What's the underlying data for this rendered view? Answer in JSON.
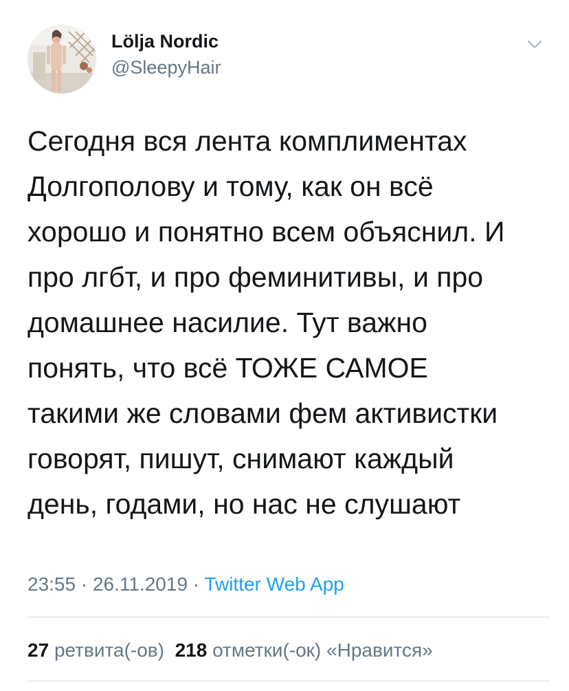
{
  "user": {
    "display_name": "Lölja Nordic",
    "handle": "@SleepyHair",
    "avatar_icon": "user-avatar"
  },
  "menu": {
    "icon": "chevron-down-icon"
  },
  "tweet": {
    "lines": [
      "Сегодня вся лента комплиментах",
      "Долгополову и тому, как он всё",
      "хорошо и понятно всем объяснил. И",
      "про лгбт, и про феминитивы, и про",
      "домашнее насилие. Тут важно",
      "понять, что всё ТОЖЕ САМОЕ",
      "такими же словами фем активистки",
      "говорят, пишут, снимают каждый",
      "день, годами, но нас не слушают"
    ]
  },
  "meta": {
    "time": "23:55",
    "separator": " · ",
    "date": "26.11.2019",
    "source": "Twitter Web App"
  },
  "stats": {
    "retweets_count": "27",
    "retweets_label": "ретвита(-ов)",
    "likes_count": "218",
    "likes_label": "отметки(-ок) «Нравится»"
  },
  "colors": {
    "text": "#14171a",
    "secondary": "#657786",
    "link": "#1da1f2",
    "divider": "#d8dee3"
  }
}
